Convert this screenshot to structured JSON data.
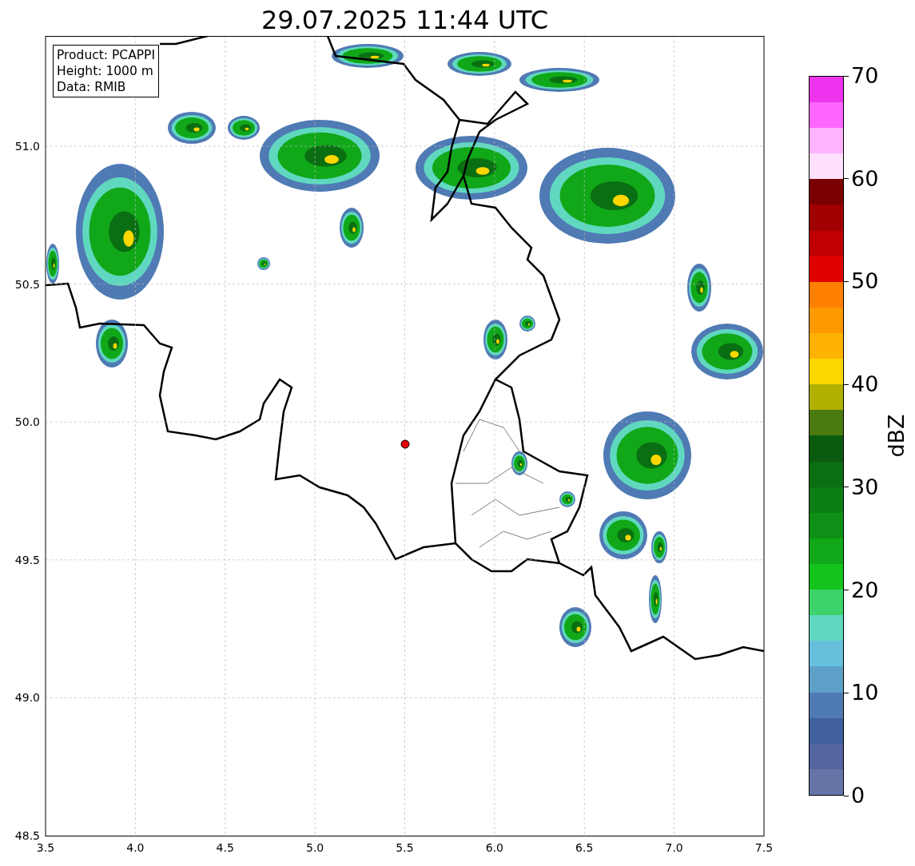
{
  "title": "29.07.2025 11:44 UTC",
  "info_box": [
    "Product: PCAPPI",
    "Height: 1000 m",
    "Data: RMIB"
  ],
  "map": {
    "xticks": [
      "3.5",
      "4.0",
      "4.5",
      "5.0",
      "5.5",
      "6.0",
      "6.5",
      "7.0",
      "7.5"
    ],
    "yticks": [
      "51.0",
      "50.5",
      "50.0",
      "49.5",
      "49.0",
      "48.5"
    ]
  },
  "colorbar": {
    "label": "dBZ",
    "ticks": [
      "70",
      "60",
      "50",
      "40",
      "30",
      "20",
      "10",
      "0"
    ],
    "segments": [
      {
        "color": "#6674a8"
      },
      {
        "color": "#52659e"
      },
      {
        "color": "#4060a0"
      },
      {
        "color": "#4f7ab4"
      },
      {
        "color": "#5ca0c8"
      },
      {
        "color": "#66c0dc"
      },
      {
        "color": "#60d8c0"
      },
      {
        "color": "#3cd46a"
      },
      {
        "color": "#14c41c"
      },
      {
        "color": "#10a818"
      },
      {
        "color": "#0d9015"
      },
      {
        "color": "#0b7e14"
      },
      {
        "color": "#0a6e12"
      },
      {
        "color": "#0a5a10"
      },
      {
        "color": "#4a7a10"
      },
      {
        "color": "#b0b000"
      },
      {
        "color": "#ffd700"
      },
      {
        "color": "#ffb300"
      },
      {
        "color": "#ff9900"
      },
      {
        "color": "#ff7f00"
      },
      {
        "color": "#e00000"
      },
      {
        "color": "#c00000"
      },
      {
        "color": "#a00000"
      },
      {
        "color": "#7a0000"
      },
      {
        "color": "#ffe0ff"
      },
      {
        "color": "#ffb3ff"
      },
      {
        "color": "#ff66ff"
      },
      {
        "color": "#ee33ee"
      }
    ]
  }
}
